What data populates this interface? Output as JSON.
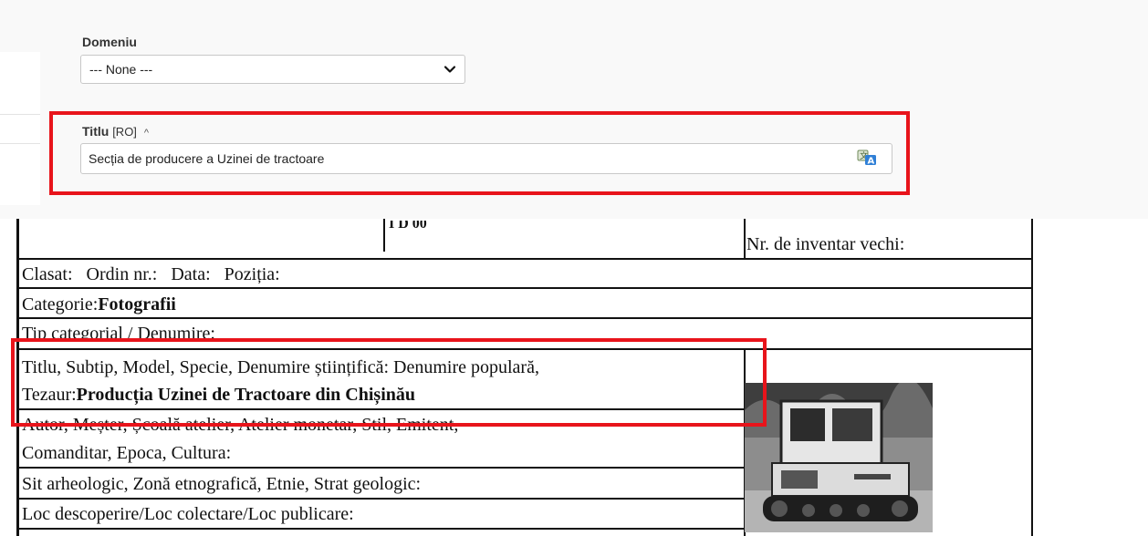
{
  "form": {
    "domeniu": {
      "label": "Domeniu",
      "selected": "--- None ---"
    },
    "titlu": {
      "label": "Titlu",
      "lang": "[RO]",
      "caret": "^",
      "value": "Secția de producere a Uzinei de tractoare"
    }
  },
  "document": {
    "top_fragment": "I D 00",
    "inventar_vechi": "Nr. de inventar vechi:",
    "clasat": "Clasat:   Ordin nr.:   Data:   Poziția:",
    "categorie_label": "Categorie:",
    "categorie_value": "Fotografii",
    "tip_categorial": "Tip categorial / Denumire:",
    "titlu_line1": "Titlu, Subtip, Model, Specie, Denumire științifică: Denumire populară,",
    "titlu_line2_label": "Tezaur:",
    "titlu_line2_value": "Producția Uzinei de Tractoare din Chișinău",
    "autor_line1": "Autor, Meșter, Școală atelier, Atelier monetar, Stil, Emitent,",
    "autor_line2": "Comanditar, Epoca, Cultura:",
    "sit": "Sit arheologic, Zonă etnografică, Etnie, Strat geologic:",
    "loc": "Loc descoperire/Loc colectare/Loc publicare:"
  },
  "colors": {
    "highlight": "#e8141b",
    "panel_bg": "#f9f9f9",
    "border": "#c8c8c8"
  },
  "icons": {
    "dropdown": "chevron-down-icon",
    "translate": "translate-icon"
  }
}
